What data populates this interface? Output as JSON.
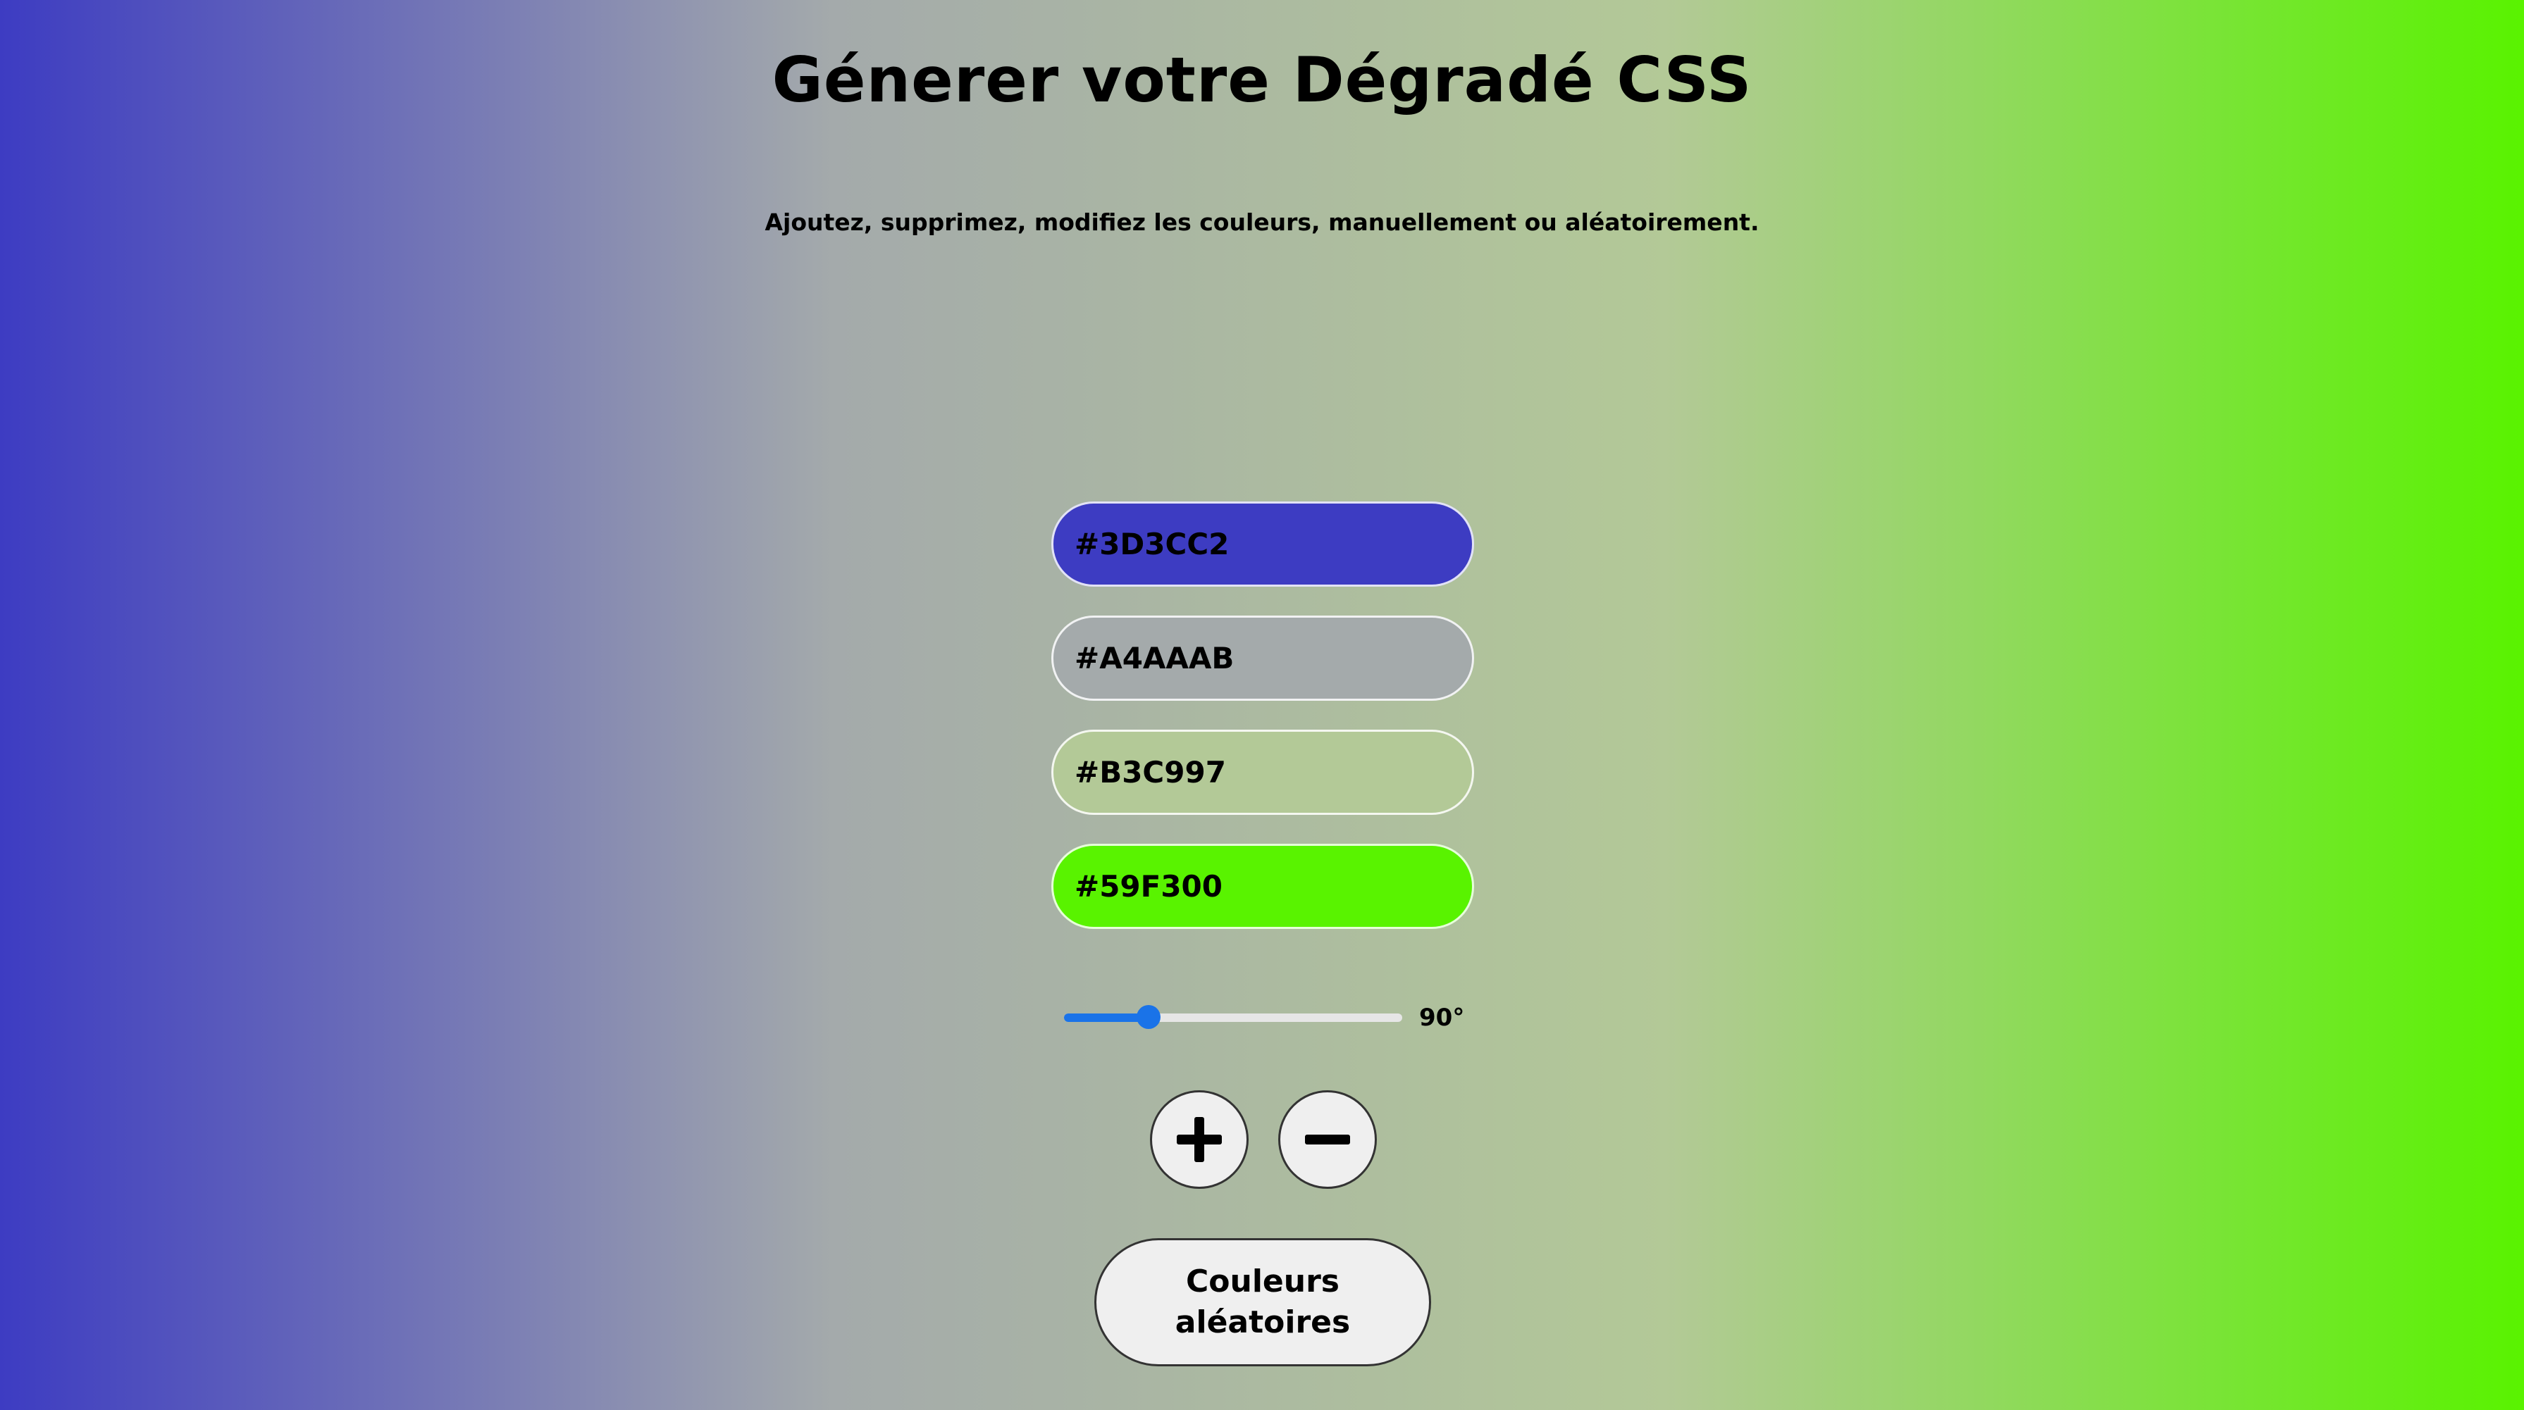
{
  "header": {
    "title": "Génerer votre Dégradé CSS",
    "subtitle": "Ajoutez, supprimez, modifiez les couleurs, manuellement ou aléatoirement."
  },
  "colors": [
    {
      "value": "#3D3CC2",
      "hex": "#3D3CC2"
    },
    {
      "value": "#A4AAAB",
      "hex": "#A4AAAB"
    },
    {
      "value": "#B3C997",
      "hex": "#B3C997"
    },
    {
      "value": "#59F300",
      "hex": "#59F300"
    }
  ],
  "angle": {
    "label": "90°",
    "value": 90,
    "max": 360
  },
  "buttons": {
    "add_icon": "plus-icon",
    "remove_icon": "minus-icon",
    "random_label": "Couleurs aléatoires"
  },
  "accent_color": "#1A73E8"
}
